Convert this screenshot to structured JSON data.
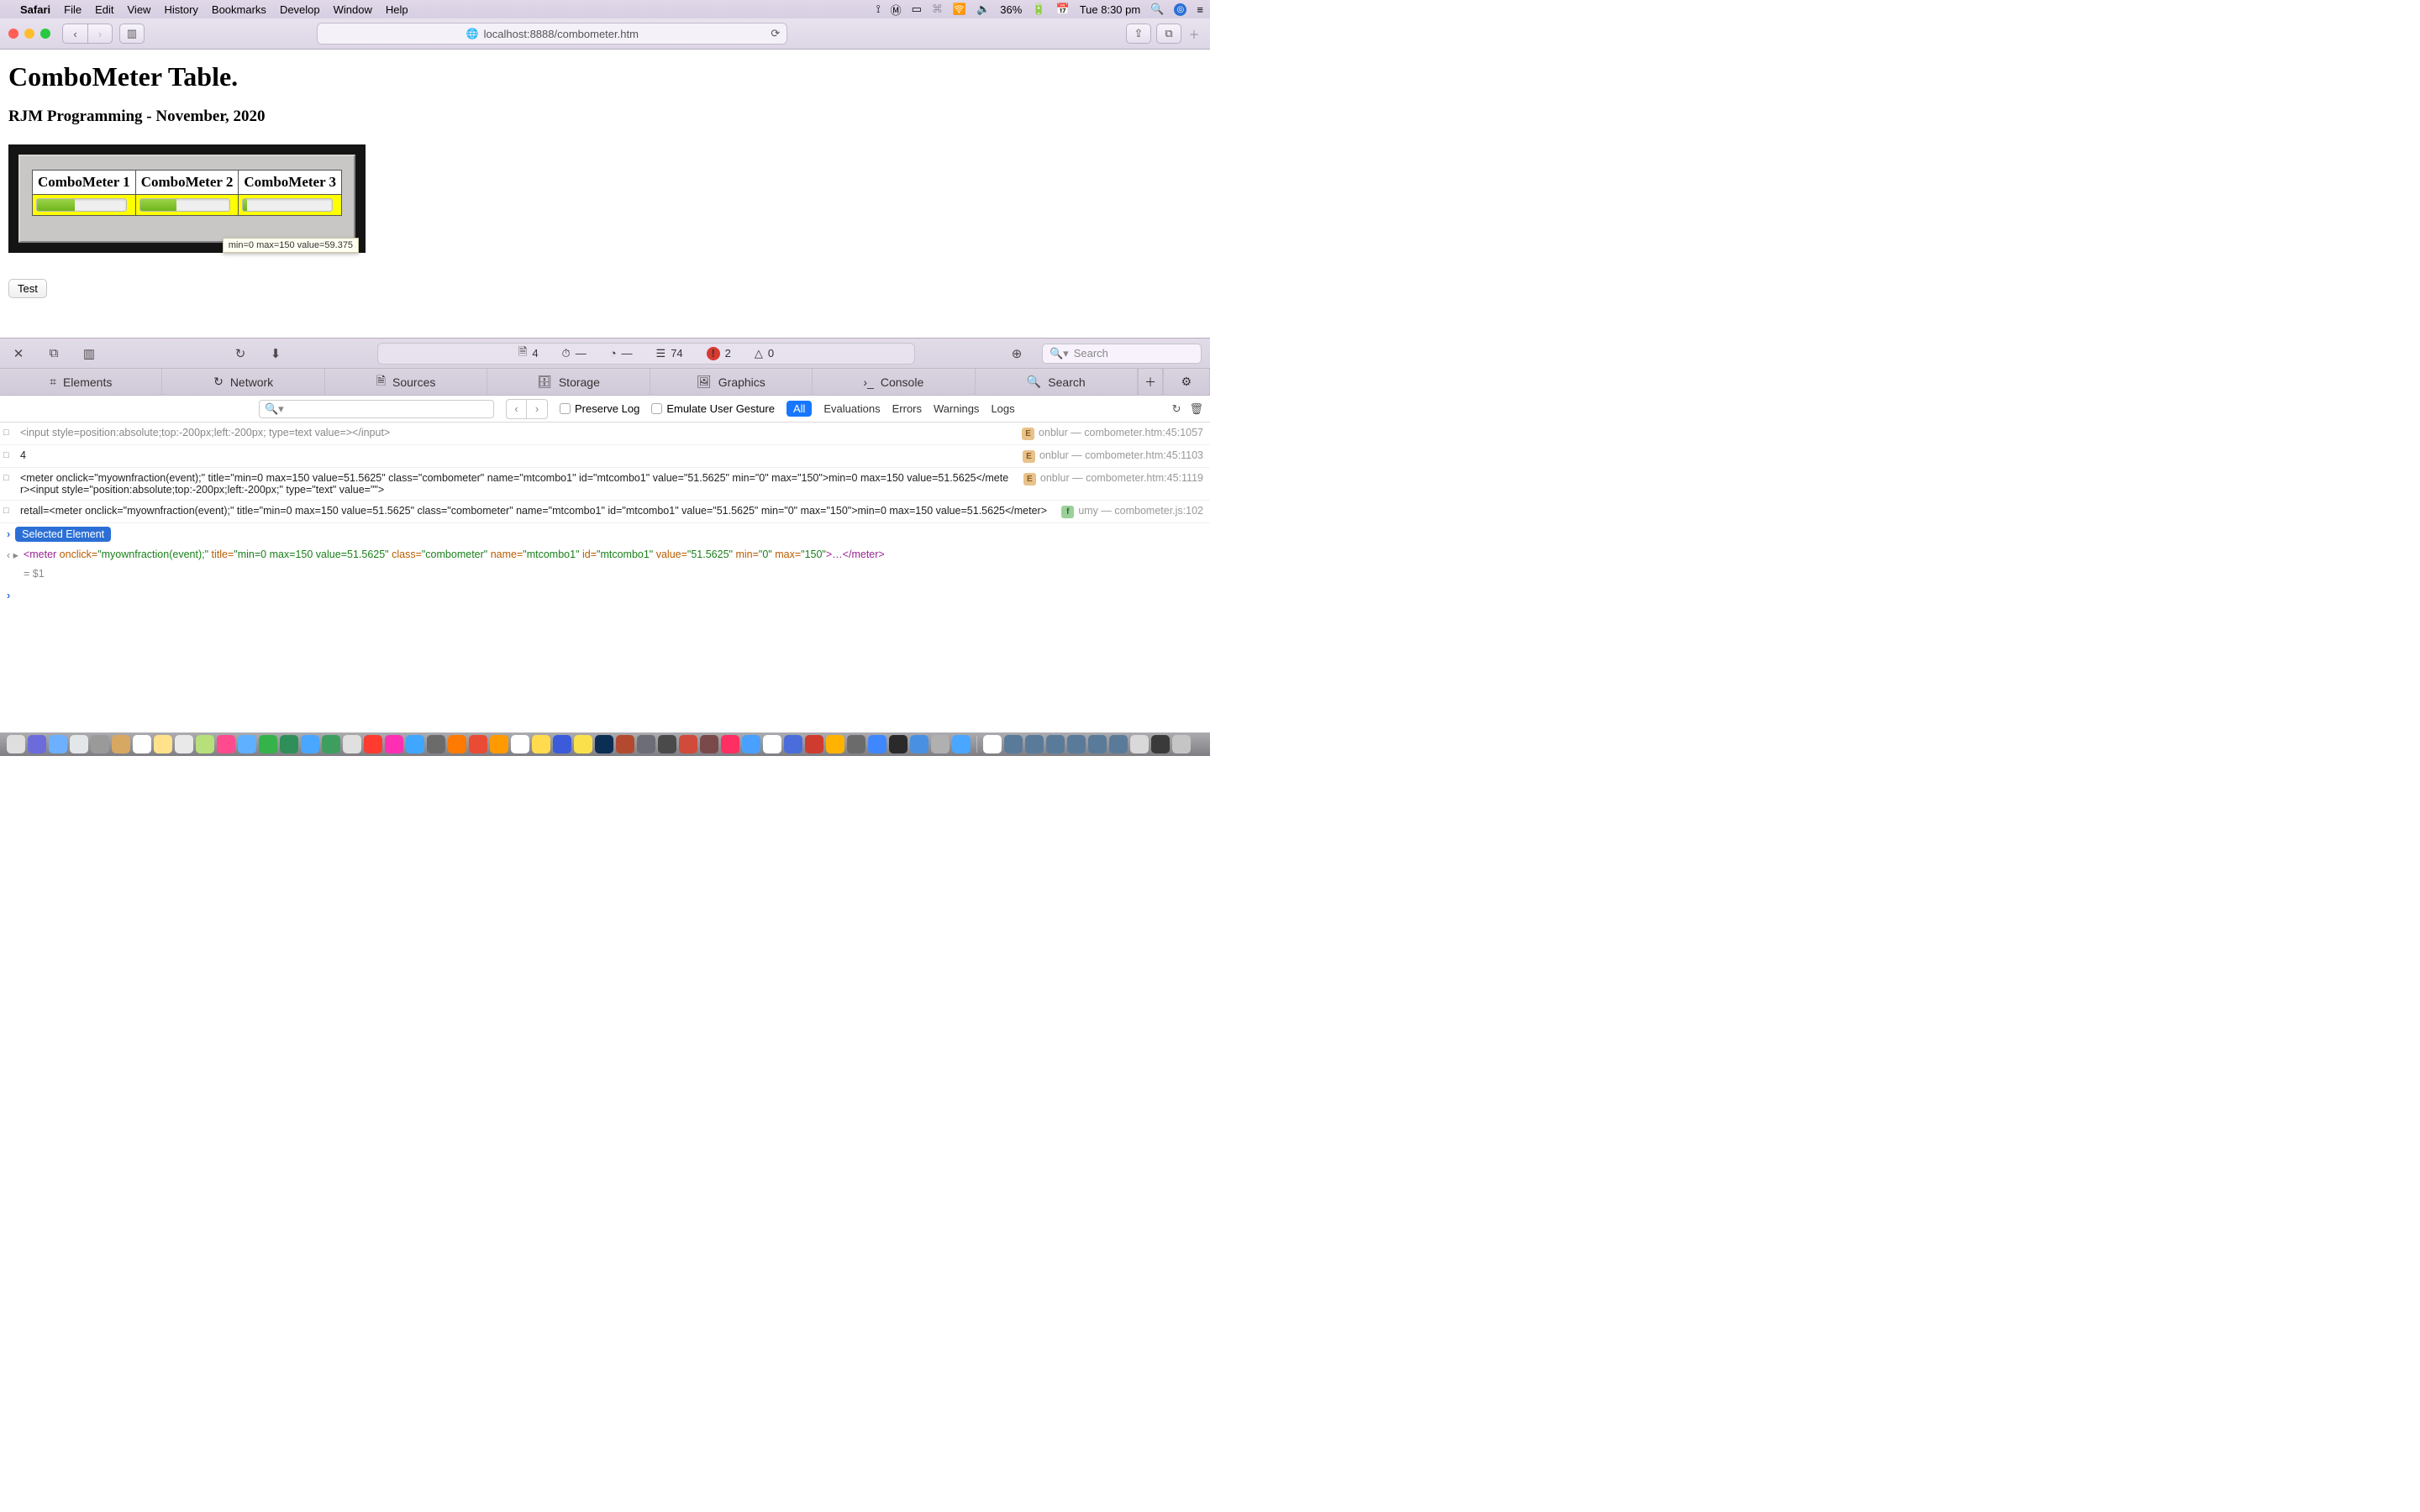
{
  "menubar": {
    "app": "Safari",
    "items": [
      "File",
      "Edit",
      "View",
      "History",
      "Bookmarks",
      "Develop",
      "Window",
      "Help"
    ],
    "battery": "36%",
    "clock": "Tue 8:30 pm"
  },
  "toolbar": {
    "url": "localhost:8888/combometer.htm"
  },
  "page": {
    "title": "ComboMeter Table.",
    "subtitle": "RJM Programming - November, 2020",
    "headers": [
      "ComboMeter 1",
      "ComboMeter 2",
      "ComboMeter 3"
    ],
    "tooltip": "min=0 max=150 value=59.375",
    "test_button": "Test"
  },
  "inspector": {
    "counts": {
      "docs": "4",
      "timer": "—",
      "clock": "—",
      "list": "74",
      "errors": "2",
      "warn": "0"
    },
    "search_placeholder": "Search",
    "tabs": [
      "Elements",
      "Network",
      "Sources",
      "Storage",
      "Graphics",
      "Console",
      "Search"
    ],
    "filter": {
      "preserve": "Preserve Log",
      "emulate": "Emulate User Gesture",
      "all": "All",
      "levels": [
        "Evaluations",
        "Errors",
        "Warnings",
        "Logs"
      ]
    },
    "rows": {
      "r0": "<input style=position:absolute;top:-200px;left:-200px; type=text value=></input>",
      "r0_src": "combometer.htm:45:1057",
      "r0_label": "onblur",
      "r1": "4",
      "r1_src": "combometer.htm:45:1103",
      "r1_label": "onblur",
      "r2": "<meter onclick=\"myownfraction(event);\" title=\"min=0 max=150 value=51.5625\" class=\"combometer\" name=\"mtcombo1\" id=\"mtcombo1\" value=\"51.5625\" min=\"0\" max=\"150\">min=0 max=150 value=51.5625</meter><input style=\"position:absolute;top:-200px;left:-200px;\" type=\"text\" value=\"\">",
      "r2_src": "combometer.htm:45:1119",
      "r2_label": "onblur",
      "r3": "retall=<meter onclick=\"myownfraction(event);\" title=\"min=0 max=150 value=51.5625\" class=\"combometer\" name=\"mtcombo1\" id=\"mtcombo1\" value=\"51.5625\" min=\"0\" max=\"150\">min=0 max=150 value=51.5625</meter>",
      "r3_src": "combometer.js:102",
      "r3_label": "umy"
    },
    "selected": "Selected Element",
    "selected_result": "= $1"
  },
  "selected_code": {
    "open": "<",
    "tag": "meter ",
    "a1": "onclick=",
    "v1": "\"myownfraction(event);\" ",
    "a2": "title=",
    "v2": "\"min=0 max=150 value=51.5625\" ",
    "a3": "class=",
    "v3": "\"combometer\" ",
    "a4": "name=",
    "v4": "\"mtcombo1\" ",
    "a5": "id=",
    "v5": "\"mtcombo1\" ",
    "a6": "value=",
    "v6": "\"51.5625\" ",
    "a7": "min=",
    "v7": "\"0\" ",
    "a8": "max=",
    "v8": "\"150\"",
    "mid": ">…</",
    "tag2": "meter",
    "close": ">"
  }
}
